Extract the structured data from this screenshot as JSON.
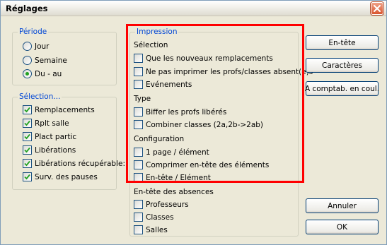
{
  "window": {
    "title": "Réglages"
  },
  "periode": {
    "legend": "Période",
    "options": [
      {
        "label": "Jour",
        "checked": false
      },
      {
        "label": "Semaine",
        "checked": false
      },
      {
        "label": "Du - au",
        "checked": true
      }
    ]
  },
  "selection": {
    "legend": "Sélection...",
    "items": [
      {
        "label": "Remplacements",
        "checked": true
      },
      {
        "label": "Rplt salle",
        "checked": true
      },
      {
        "label": "Plact partic",
        "checked": true
      },
      {
        "label": "Libérations",
        "checked": true
      },
      {
        "label": "Libérations récupérable:",
        "checked": true
      },
      {
        "label": "Surv. des pauses",
        "checked": true
      }
    ]
  },
  "impression": {
    "legend": "Impression",
    "selection_heading": "Sélection",
    "selection_items": [
      {
        "label": "Que les nouveaux remplacements",
        "checked": false
      },
      {
        "label": "Ne pas imprimer les profs/classes absent(e)s",
        "checked": false
      },
      {
        "label": "Evénements",
        "checked": false
      }
    ],
    "type_heading": "Type",
    "type_items": [
      {
        "label": "Biffer les profs libérés",
        "checked": false
      },
      {
        "label": "Combiner classes (2a,2b->2ab)",
        "checked": false
      }
    ],
    "config_heading": "Configuration",
    "config_items": [
      {
        "label": "1 page / élément",
        "checked": false
      },
      {
        "label": "Comprimer en-tête des éléments",
        "checked": false
      },
      {
        "label": "En-tête / Elément",
        "checked": false
      }
    ],
    "absences_heading": "En-tête des absences",
    "absences_items": [
      {
        "label": "Professeurs",
        "checked": false
      },
      {
        "label": "Classes",
        "checked": false
      },
      {
        "label": "Salles",
        "checked": false
      }
    ]
  },
  "buttons": {
    "entete": "En-tête",
    "caracteres": "Caractères",
    "comptab": "A comptab. en coul.",
    "annuler": "Annuler",
    "ok": "OK"
  },
  "colors": {
    "highlight": "#ff0000",
    "legend": "#0046d5",
    "check": "#21a121"
  }
}
